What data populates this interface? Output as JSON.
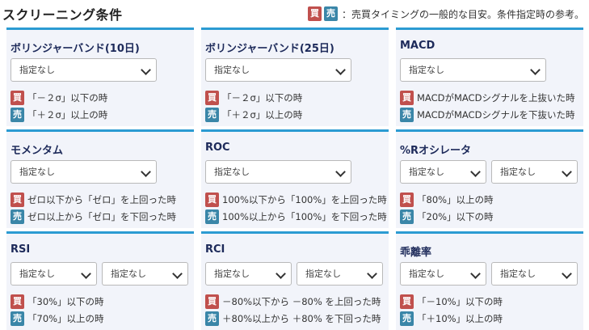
{
  "header": {
    "title": "スクリーニング条件",
    "legend_buy": "買",
    "legend_sell": "売",
    "legend_text": "：売買タイミングの一般的な目安。条件指定時の参考。"
  },
  "colors": {
    "accent": "#2b9bd2",
    "buy": "#c0504d",
    "sell": "#3a86a8",
    "panel": "#f2f4fa"
  },
  "cells": [
    {
      "title": "ボリンジャーバンド(10日)",
      "selects": [
        "指定なし"
      ],
      "buy_label": "買",
      "buy": "「－２σ」以下の時",
      "sell_label": "売",
      "sell": "「＋２σ」以上の時"
    },
    {
      "title": "ボリンジャーバンド(25日)",
      "selects": [
        "指定なし"
      ],
      "buy_label": "買",
      "buy": "「－２σ」以下の時",
      "sell_label": "売",
      "sell": "「＋２σ」以上の時"
    },
    {
      "title": "MACD",
      "selects": [
        "指定なし"
      ],
      "buy_label": "買",
      "buy": "MACDがMACDシグナルを上抜いた時",
      "sell_label": "売",
      "sell": "MACDがMACDシグナルを下抜いた時"
    },
    {
      "title": "モメンタム",
      "selects": [
        "指定なし"
      ],
      "buy_label": "買",
      "buy": "ゼロ以下から「ゼロ」を上回った時",
      "sell_label": "売",
      "sell": "ゼロ以上から「ゼロ」を下回った時"
    },
    {
      "title": "ROC",
      "selects": [
        "指定なし"
      ],
      "buy_label": "買",
      "buy": "100%以下から「100%」を上回った時",
      "sell_label": "売",
      "sell": "100%以上から「100%」を下回った時"
    },
    {
      "title": "%Rオシレータ",
      "selects": [
        "指定なし",
        "指定なし"
      ],
      "buy_label": "買",
      "buy": "「80%」以上の時",
      "sell_label": "売",
      "sell": "「20%」以下の時"
    },
    {
      "title": "RSI",
      "selects": [
        "指定なし",
        "指定なし"
      ],
      "buy_label": "買",
      "buy": "「30%」以下の時",
      "sell_label": "売",
      "sell": "「70%」以上の時"
    },
    {
      "title": "RCI",
      "selects": [
        "指定なし",
        "指定なし"
      ],
      "buy_label": "買",
      "buy": "－80%以下から －80% を上回った時",
      "sell_label": "売",
      "sell": "＋80%以上から ＋80% を下回った時"
    },
    {
      "title": "乖離率",
      "selects": [
        "指定なし",
        "指定なし"
      ],
      "buy_label": "買",
      "buy": "「－10%」以下の時",
      "sell_label": "売",
      "sell": "「＋10%」以上の時"
    }
  ]
}
